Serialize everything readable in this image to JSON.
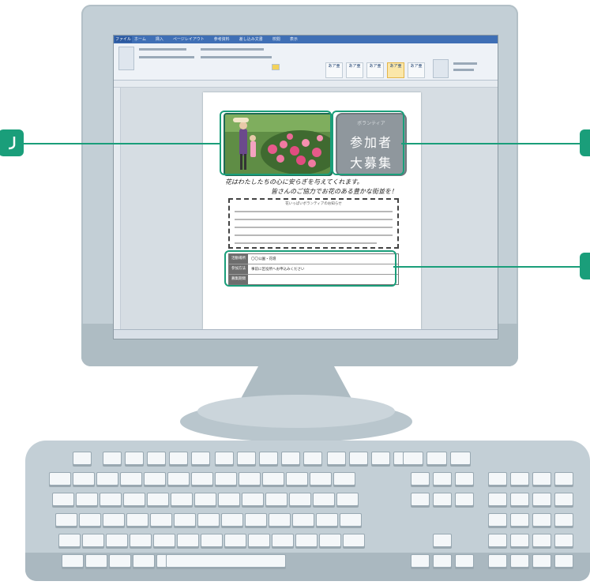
{
  "word": {
    "title_text": "",
    "file_tab": "ファイル",
    "tabs": [
      "ホーム",
      "挿入",
      "ページレイアウト",
      "参考資料",
      "差し込み文書",
      "校閲",
      "表示"
    ],
    "style_tiles": [
      "あア亜",
      "あア亜",
      "あア亜",
      "あア亜",
      "あア亜"
    ]
  },
  "flyer": {
    "pill_small": "ボランティア",
    "pill_line1": "参加者",
    "pill_line2": "大募集",
    "headline1": "花はわたしたちの心に安らぎを与えてくれます。",
    "headline2": "皆さんのご協力でお花のある豊かな街並を！",
    "notice_title": "花いっぱいボランティアのお知らせ",
    "table": [
      {
        "label": "活動場所",
        "value": "〇〇公園・花壇"
      },
      {
        "label": "参加方法",
        "value": "事前に区役所へお申込みください"
      },
      {
        "label": "募集期間",
        "value": ""
      }
    ]
  },
  "colors": {
    "accent": "#1a9e7a",
    "screen_bg": "#d6dde3",
    "monitor_body": "#c3cfd6"
  }
}
